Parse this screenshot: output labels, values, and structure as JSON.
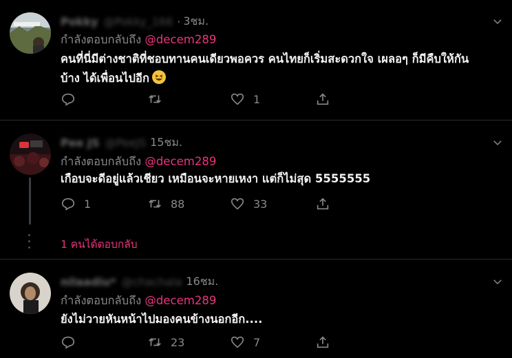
{
  "tweets": [
    {
      "name": "Pokky",
      "handle": "@Pokky_166",
      "dot": "·",
      "time": "3ชม.",
      "reply_prefix": "กำลังตอบกลับถึง",
      "reply_to": "@decem289",
      "text_line1": "คนที่นี่มีต่างชาติที่ชอบทานคนเดียวพอควร คนไทยก็เริ่มสะดวกใจ เผลอๆ ก็มีคืบให้กัน",
      "text_line2": "บ้าง ได้เพื่อนไปอีก",
      "emoji_icon": "grinning-squinting-face-icon",
      "replies": "",
      "retweets": "",
      "likes": "1"
    },
    {
      "name": "Pee JS",
      "handle": "@PeeJS",
      "dot": "",
      "time": "15ชม.",
      "reply_prefix": "กำลังตอบกลับถึง",
      "reply_to": "@decem289",
      "text_line1": "เกือบจะดีอยู่แล้วเชียว เหมือนจะหายเหงา แต่ก็ไม่สุด 5555555",
      "replies": "1",
      "retweets": "88",
      "likes": "33"
    },
    {
      "name": "nilaadiu*",
      "handle": "@chachala",
      "dot": "",
      "time": "16ชม.",
      "reply_prefix": "กำลังตอบกลับถึง",
      "reply_to": "@decem289",
      "text_line1": "ยังไม่วายหันหน้าไปมองคนข้างนอกอีก....",
      "replies": "",
      "retweets": "23",
      "likes": "7"
    }
  ],
  "more_replies": "1 คนได้ตอบกลับ",
  "colors": {
    "accent": "#e8357a",
    "background": "#000000",
    "muted": "#8a8a8a"
  }
}
